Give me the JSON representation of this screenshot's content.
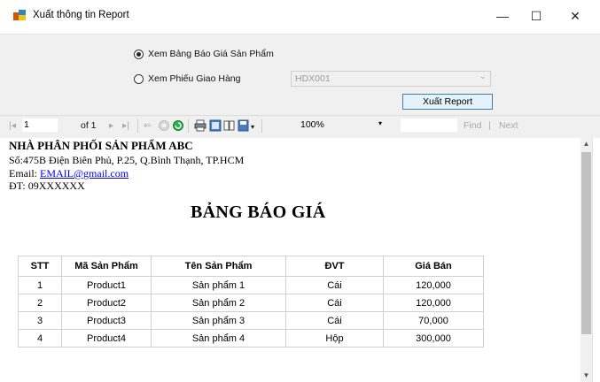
{
  "window": {
    "title": "Xuất thông tin Report",
    "minimize": "—",
    "maximize": "☐",
    "close": "✕"
  },
  "form": {
    "radio_bao_gia": "Xem Bảng Báo Giá Sản Phẩm",
    "radio_phieu_giao": "Xem Phiếu Giao Hàng",
    "combo_value": "HDX001",
    "export_button": "Xuất Report"
  },
  "toolbar": {
    "page_current": "1",
    "page_of": "of 1",
    "zoom": "100%",
    "find": "Find",
    "next": "Next"
  },
  "report": {
    "company": "NHÀ PHÂN PHỐI SẢN PHẨM ABC",
    "address": "Số:475B Điện Biên Phủ, P.25, Q.Bình Thạnh, TP.HCM",
    "email_label": "Email:",
    "email": "EMAIL@gmail.com",
    "phone": "ĐT:  09XXXXXX",
    "title": "BẢNG BÁO GIÁ",
    "columns": [
      "STT",
      "Mã Sản Phẩm",
      "Tên Sản Phẩm",
      "ĐVT",
      "Giá Bán"
    ],
    "rows": [
      [
        "1",
        "Product1",
        "Sản phẩm 1",
        "Cái",
        "120,000"
      ],
      [
        "2",
        "Product2",
        "Sản phẩm 2",
        "Cái",
        "120,000"
      ],
      [
        "3",
        "Product3",
        "Sản phẩm 3",
        "Cái",
        "70,000"
      ],
      [
        "4",
        "Product4",
        "Sản phẩm 4",
        "Hộp",
        "300,000"
      ]
    ]
  },
  "colors": {
    "accent_button_border": "#3c7fb1",
    "accent_button_bg": "#e5f1fb",
    "link": "#0000ee"
  }
}
